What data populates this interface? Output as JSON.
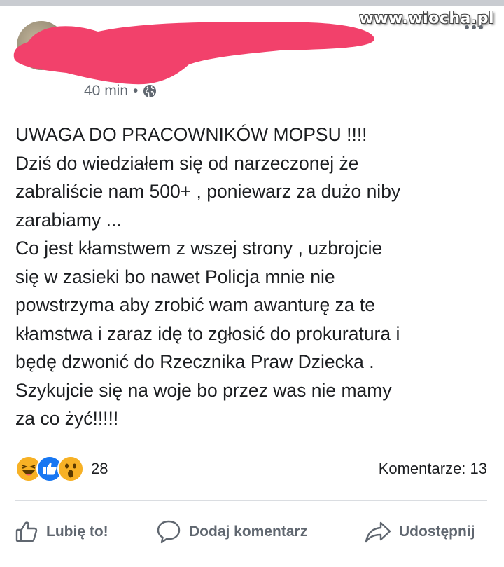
{
  "watermark": "www.wiocha.pl",
  "post": {
    "time": "40 min",
    "separator": "•",
    "lines": [
      "UWAGA DO PRACOWNIKÓW MOPSU !!!!",
      "Dziś do wiedziałem się od narzeczonej że",
      "zabraliście nam 500+ , poniewarz za dużo niby",
      "zarabiamy ...",
      "Co jest kłamstwem z wszej strony , uzbrojcie",
      "się w zasieki bo nawet Policja mnie nie",
      "powstrzyma aby zrobić wam awanturę za te",
      "kłamstwa i zaraz idę to zgłosić do prokuratura i",
      "będę dzwonić do Rzecznika Praw Dziecka .",
      "Szykujcie się na woje bo przez was nie mamy",
      "za co żyć!!!!!"
    ]
  },
  "reactions": {
    "icons": [
      "haha-icon",
      "like-icon",
      "wow-icon"
    ],
    "count": "28",
    "comments": "Komentarze: 13"
  },
  "actions": {
    "like": "Lubię to!",
    "comment": "Dodaj komentarz",
    "share": "Udostępnij"
  },
  "colors": {
    "redaction": "#f2416b",
    "like_blue": "#1877f2",
    "reaction_yellow": "#f7b125",
    "secondary_text": "#606770"
  }
}
